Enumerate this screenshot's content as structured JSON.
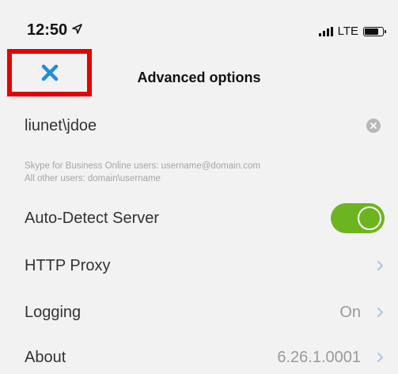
{
  "status_bar": {
    "time": "12:50",
    "location_icon": "location-arrow-icon",
    "network": "LTE",
    "signal_icon": "cellular-signal-icon",
    "battery_icon": "battery-icon"
  },
  "nav": {
    "title": "Advanced options",
    "close_icon": "close-icon",
    "close_color": "#1f8fd6",
    "highlight_color": "#e40000"
  },
  "username_field": {
    "value": "liunet\\jdoe",
    "clear_icon": "clear-icon"
  },
  "hint": {
    "line1": "Skype for Business Online users: username@domain.com",
    "line2": "All other users: domain\\username"
  },
  "settings": {
    "auto_detect": {
      "label": "Auto-Detect Server",
      "enabled": true,
      "toggle_color": "#6cb520"
    },
    "http_proxy": {
      "label": "HTTP Proxy"
    },
    "logging": {
      "label": "Logging",
      "value": "On"
    },
    "about": {
      "label": "About",
      "value": "6.26.1.0001"
    }
  }
}
